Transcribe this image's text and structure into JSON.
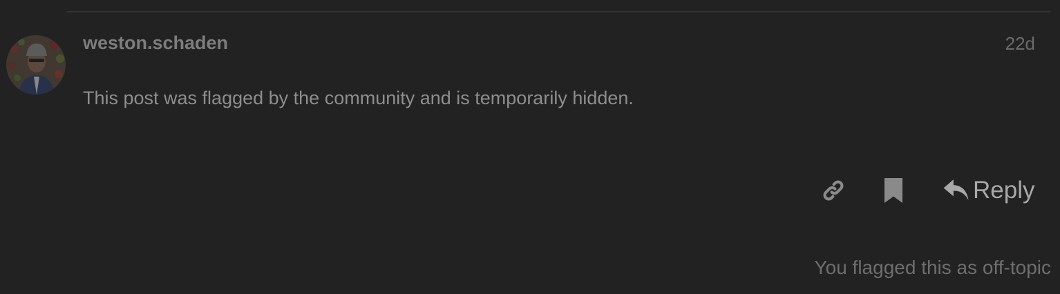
{
  "post": {
    "username": "weston.schaden",
    "date": "22d",
    "body": "This post was flagged by the community and is temporarily hidden.",
    "avatar_alt": "weston.schaden avatar"
  },
  "actions": {
    "link_icon": "link-icon",
    "bookmark_icon": "bookmark-icon",
    "reply_icon": "reply-arrow-icon",
    "reply_label": "Reply"
  },
  "flag_notice": "You flagged this as off-topic",
  "colors": {
    "background": "#222222",
    "text_muted": "#8e8e8e",
    "divider": "#333333"
  }
}
